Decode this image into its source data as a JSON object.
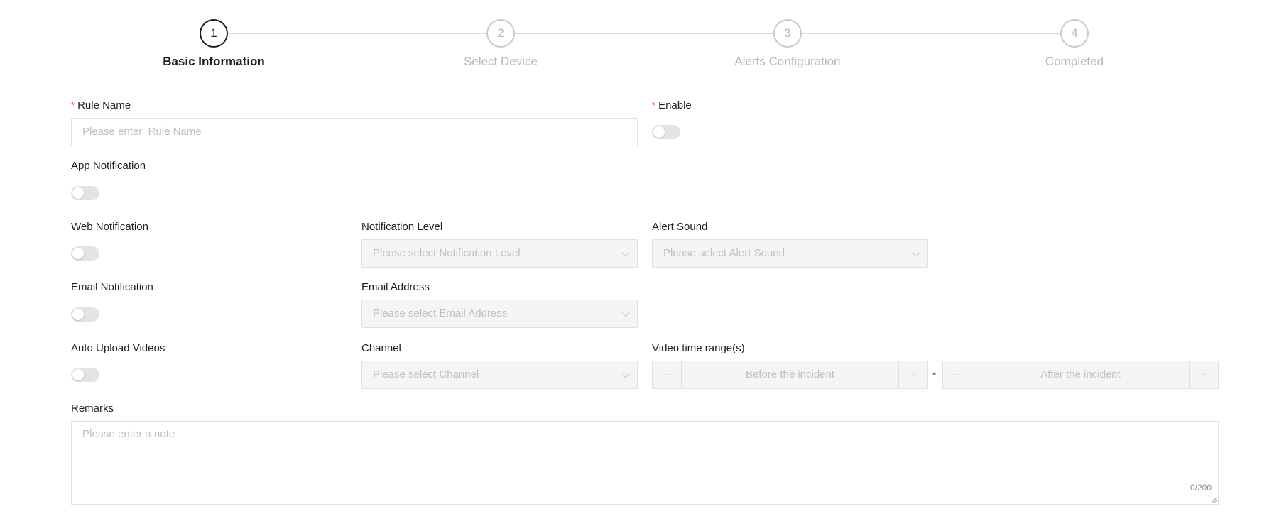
{
  "steps": [
    {
      "number": "1",
      "title": "Basic Information",
      "state": "active"
    },
    {
      "number": "2",
      "title": "Select Device",
      "state": "pending"
    },
    {
      "number": "3",
      "title": "Alerts Configuration",
      "state": "pending"
    },
    {
      "number": "4",
      "title": "Completed",
      "state": "pending"
    }
  ],
  "form": {
    "required_mark": "*",
    "rule_name": {
      "label": "Rule Name",
      "placeholder": "Please enter  Rule Name",
      "value": ""
    },
    "enable": {
      "label": "Enable",
      "on": false
    },
    "app_notification": {
      "label": "App Notification",
      "on": false
    },
    "web_notification": {
      "label": "Web Notification",
      "on": false
    },
    "notification_level": {
      "label": "Notification Level",
      "placeholder": "Please select Notification Level"
    },
    "alert_sound": {
      "label": "Alert Sound",
      "placeholder": "Please select Alert Sound"
    },
    "email_notification": {
      "label": "Email Notification",
      "on": false
    },
    "email_address": {
      "label": "Email Address",
      "placeholder": "Please select Email Address"
    },
    "auto_upload_videos": {
      "label": "Auto Upload Videos",
      "on": false
    },
    "channel": {
      "label": "Channel",
      "placeholder": "Please select Channel"
    },
    "video_time_range": {
      "label": "Video time range(s)",
      "before_placeholder": "Before the incident",
      "after_placeholder": "After the incident",
      "minus": "−",
      "plus": "+",
      "separator": "-"
    },
    "remarks": {
      "label": "Remarks",
      "placeholder": "Please enter a note",
      "counter": "0/200"
    }
  },
  "colors": {
    "active": "#1f1f1f",
    "inactive": "#b8b8b8",
    "required": "#ff4d4f",
    "switch_off": "#e4e4e7"
  }
}
